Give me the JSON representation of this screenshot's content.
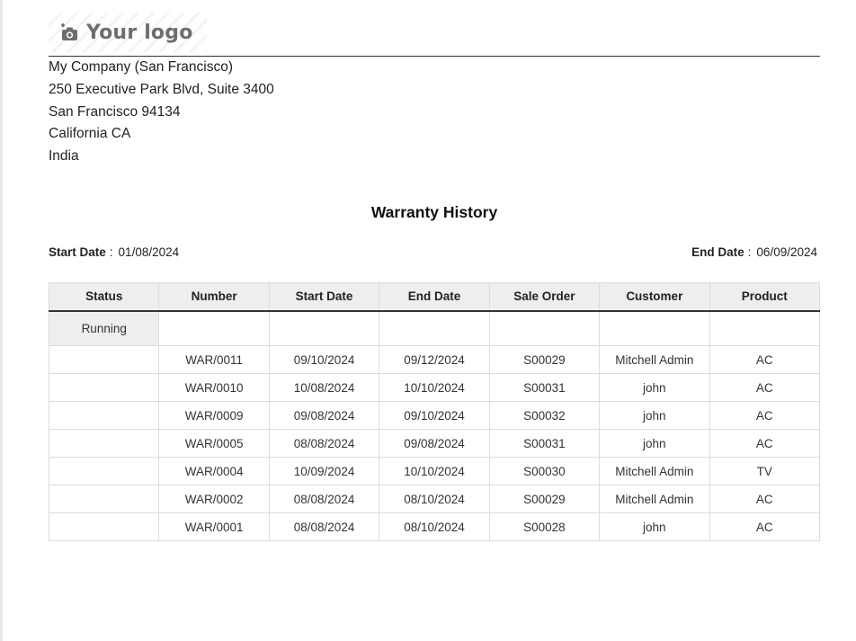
{
  "logo": {
    "text": "Your logo",
    "icon": "camera-plus-icon",
    "color": "#6e6e6e"
  },
  "company": {
    "lines": [
      "My Company (San Francisco)",
      "250 Executive Park Blvd, Suite 3400",
      "San Francisco 94134",
      "California CA",
      "India"
    ]
  },
  "report": {
    "title": "Warranty History",
    "start_label": "Start Date",
    "start_value": "01/08/2024",
    "end_label": "End Date",
    "end_value": "06/09/2024",
    "separator": ":"
  },
  "table": {
    "headers": [
      "Status",
      "Number",
      "Start Date",
      "End Date",
      "Sale Order",
      "Customer",
      "Product"
    ],
    "group_label": "Running",
    "rows": [
      [
        "WAR/0011",
        "09/10/2024",
        "09/12/2024",
        "S00029",
        "Mitchell Admin",
        "AC"
      ],
      [
        "WAR/0010",
        "10/08/2024",
        "10/10/2024",
        "S00031",
        "john",
        "AC"
      ],
      [
        "WAR/0009",
        "09/08/2024",
        "09/10/2024",
        "S00032",
        "john",
        "AC"
      ],
      [
        "WAR/0005",
        "08/08/2024",
        "09/08/2024",
        "S00031",
        "john",
        "AC"
      ],
      [
        "WAR/0004",
        "10/09/2024",
        "10/10/2024",
        "S00030",
        "Mitchell Admin",
        "TV"
      ],
      [
        "WAR/0002",
        "08/08/2024",
        "08/10/2024",
        "S00029",
        "Mitchell Admin",
        "AC"
      ],
      [
        "WAR/0001",
        "08/08/2024",
        "08/10/2024",
        "S00028",
        "john",
        "AC"
      ]
    ]
  }
}
